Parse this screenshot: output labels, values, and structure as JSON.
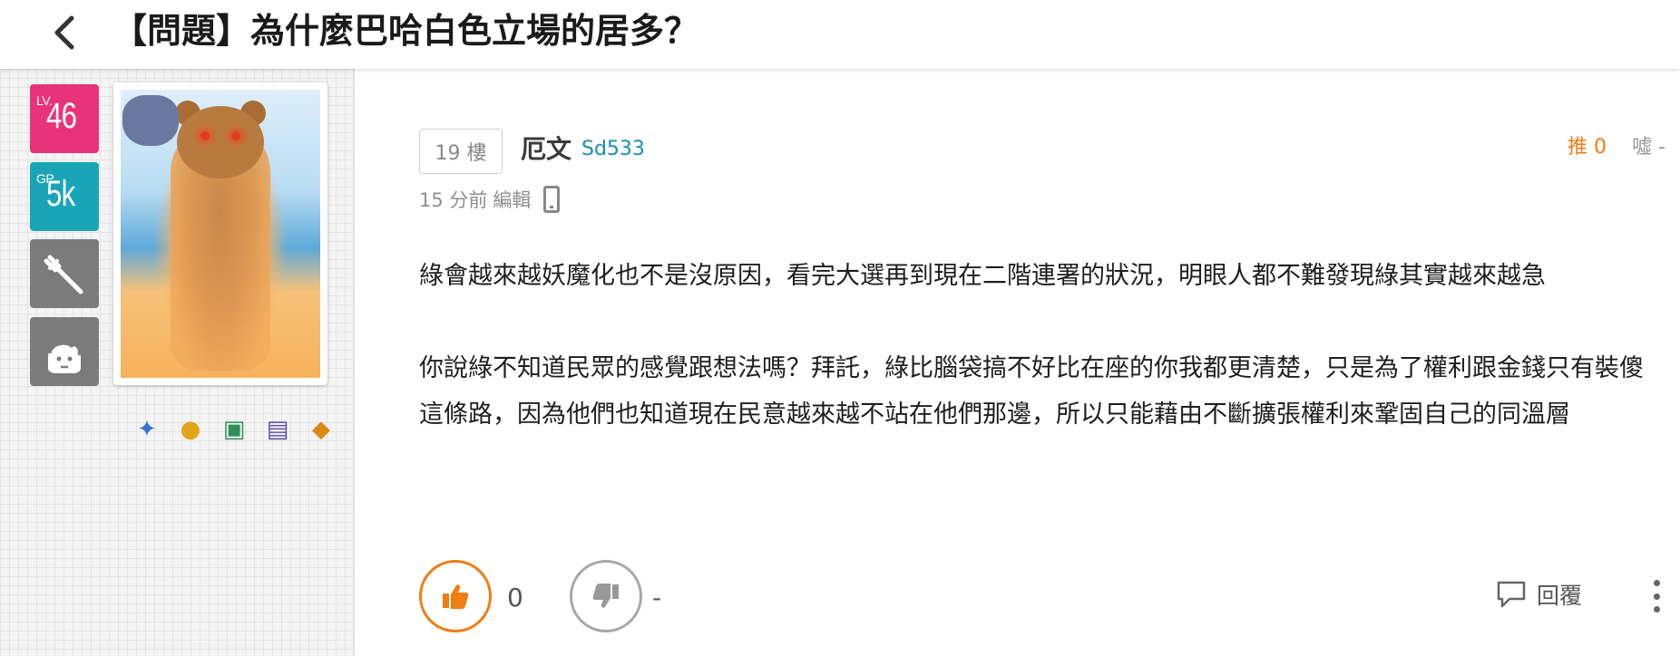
{
  "header": {
    "title": "【問題】為什麼巴哈白色立場的居多？",
    "back_icon": "chevron-left-icon"
  },
  "sidebar": {
    "level": {
      "prefix": "LV.",
      "value": "46",
      "color": "#e8337a"
    },
    "gp": {
      "prefix": "GP",
      "value": "5k",
      "color": "#1aa5b7"
    },
    "tool_icon": "wrench-icon",
    "profile_icon": "face-icon",
    "medals": [
      "medal-icon",
      "coin-icon",
      "calendar-365-icon",
      "chest-icon",
      "money-bag-icon"
    ]
  },
  "post": {
    "floor": "19 樓",
    "author_name": "厄文",
    "author_id": "Sd533",
    "push_label": "推 0",
    "boo_label": "噓 -",
    "time": "15 分前",
    "edit_label": "編輯",
    "device_icon": "mobile-icon",
    "paragraphs": [
      "綠會越來越妖魔化也不是沒原因，看完大選再到現在二階連署的狀況，明眼人都不難發現綠其實越來越急",
      "你說綠不知道民眾的感覺跟想法嗎？拜託，綠比腦袋搞不好比在座的你我都更清楚，只是為了權利跟金錢只有裝傻這條路，因為他們也知道現在民意越來越不站在他們那邊，所以只能藉由不斷擴張權利來鞏固自己的同溫層"
    ],
    "like_count": "0",
    "dislike_count": "-",
    "reply_label": "回覆",
    "accent": "#f07c12"
  }
}
